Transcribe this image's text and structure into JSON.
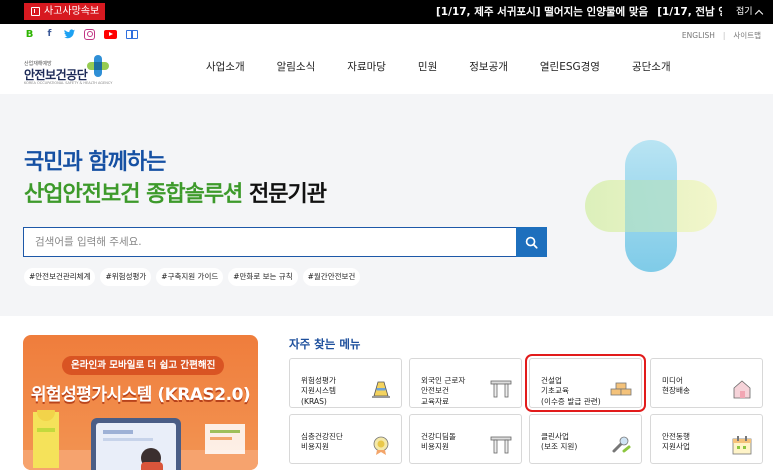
{
  "alert": {
    "badge": "사고사망속보",
    "ticker": [
      "[1/17, 제주 서귀포시] 떨어지는 인양물에 맞음",
      "[1/17, 전남 영암군] 채굴"
    ],
    "fold_label": "접기"
  },
  "social": [
    {
      "icon": "blog-icon",
      "glyph": "B"
    },
    {
      "icon": "facebook-icon",
      "glyph": "f"
    },
    {
      "icon": "twitter-icon",
      "glyph": "t"
    },
    {
      "icon": "instagram-icon",
      "glyph": ""
    },
    {
      "icon": "youtube-icon",
      "glyph": ""
    },
    {
      "icon": "book-icon",
      "glyph": ""
    }
  ],
  "toplinks": {
    "english": "ENGLISH",
    "sitemap": "사이트맵"
  },
  "logo": {
    "sub": "산업재해예방",
    "name": "안전보건공단",
    "eng": "KOREA OCCUPATIONAL SAFETY & HEALTH AGENCY"
  },
  "gnb": [
    "사업소개",
    "알림소식",
    "자료마당",
    "민원",
    "정보공개",
    "열린ESG경영",
    "공단소개"
  ],
  "hero": {
    "line1": "국민과 함께하는",
    "line2_green": "산업안전보건 종합솔루션",
    "line2_black": "전문기관",
    "search_placeholder": "검색어를 입력해 주세요.",
    "tags": [
      "#안전보건관리체계",
      "#위험성평가",
      "#구축지원 가이드",
      "#만화로 보는 규칙",
      "#월간안전보건"
    ]
  },
  "banner": {
    "pill": "온라인과 모바일로 더 쉽고 간편해진",
    "title": "위험성평가시스템 (KRAS2.0)"
  },
  "frequent": {
    "title": "자주 찾는 메뉴",
    "cards": [
      {
        "label": "위험성평가\n지원시스템\n(KRAS)",
        "icon": "cone-icon"
      },
      {
        "label": "외국인 근로자\n안전보건\n교육자료",
        "icon": "gate-icon"
      },
      {
        "label": "건설업\n기초교육\n(이수증 발급 관련)",
        "icon": "bricks-icon"
      },
      {
        "label": "미디어\n현장배송",
        "icon": "house-icon"
      },
      {
        "label": "심층건강진단\n비용지원",
        "icon": "medal-icon"
      },
      {
        "label": "건강디딤돌\n비용지원",
        "icon": "gate-icon"
      },
      {
        "label": "클린사업\n(보조 지원)",
        "icon": "wrench-icon"
      },
      {
        "label": "안전동행\n지원사업",
        "icon": "calendar-icon"
      }
    ]
  },
  "colors": {
    "brand_blue": "#1550a3",
    "brand_green": "#3d9a2b",
    "alert_red": "#d71920",
    "banner_orange": "#ef7d3c",
    "highlight": "#e21b1b"
  }
}
